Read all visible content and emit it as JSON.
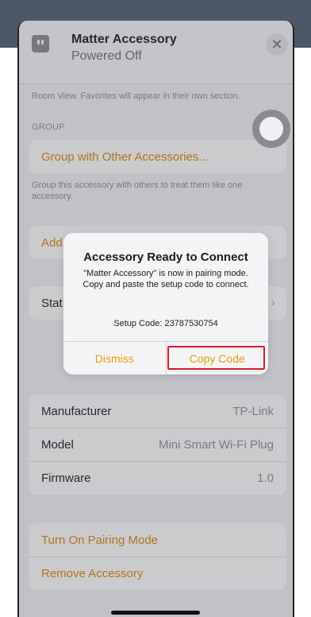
{
  "header": {
    "title": "Matter Accessory",
    "subtitle": "Powered Off",
    "close_icon": "close-icon",
    "accessory_icon": "plug-icon"
  },
  "main": {
    "room_note": "Room View. Favorites will appear in their own section.",
    "group_label": "GROUP",
    "group_button": "Group with Other Accessories...",
    "group_note": "Group this accessory with others to treat them like one accessory.",
    "add_label": "Add",
    "status_label": "Stat",
    "info": [
      {
        "label": "Manufacturer",
        "value": "TP-Link"
      },
      {
        "label": "Model",
        "value": "Mini Smart Wi-Fi Plug"
      },
      {
        "label": "Firmware",
        "value": "1.0"
      }
    ],
    "actions": [
      "Turn On Pairing Mode",
      "Remove Accessory"
    ]
  },
  "alert": {
    "title": "Accessory Ready to Connect",
    "message": "\"Matter Accessory\" is now in pairing mode. Copy and paste the setup code to connect.",
    "setup_code": "Setup Code: 23787530754",
    "dismiss": "Dismiss",
    "copy": "Copy Code"
  },
  "colors": {
    "accent": "#d38a0a",
    "highlight": "#d91e2b"
  }
}
